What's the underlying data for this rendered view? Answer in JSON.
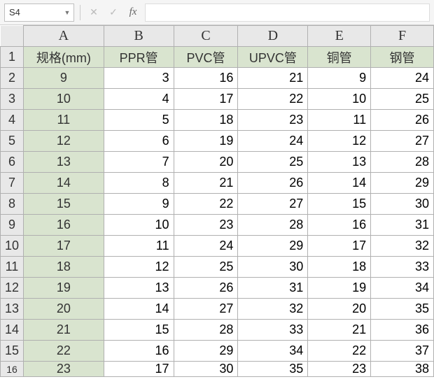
{
  "formula_bar": {
    "name_box": "S4",
    "formula_value": ""
  },
  "columns": [
    "A",
    "B",
    "C",
    "D",
    "E",
    "F"
  ],
  "header_row": {
    "A": "规格(mm)",
    "B": "PPR管",
    "C": "PVC管",
    "D": "UPVC管",
    "E": "铜管",
    "F": "钢管"
  },
  "rows": [
    {
      "n": "1",
      "type": "header"
    },
    {
      "n": "2",
      "spec": "9",
      "v": [
        "3",
        "16",
        "21",
        "9",
        "24"
      ]
    },
    {
      "n": "3",
      "spec": "10",
      "v": [
        "4",
        "17",
        "22",
        "10",
        "25"
      ]
    },
    {
      "n": "4",
      "spec": "11",
      "v": [
        "5",
        "18",
        "23",
        "11",
        "26"
      ]
    },
    {
      "n": "5",
      "spec": "12",
      "v": [
        "6",
        "19",
        "24",
        "12",
        "27"
      ]
    },
    {
      "n": "6",
      "spec": "13",
      "v": [
        "7",
        "20",
        "25",
        "13",
        "28"
      ]
    },
    {
      "n": "7",
      "spec": "14",
      "v": [
        "8",
        "21",
        "26",
        "14",
        "29"
      ]
    },
    {
      "n": "8",
      "spec": "15",
      "v": [
        "9",
        "22",
        "27",
        "15",
        "30"
      ]
    },
    {
      "n": "9",
      "spec": "16",
      "v": [
        "10",
        "23",
        "28",
        "16",
        "31"
      ]
    },
    {
      "n": "10",
      "spec": "17",
      "v": [
        "11",
        "24",
        "29",
        "17",
        "32"
      ]
    },
    {
      "n": "11",
      "spec": "18",
      "v": [
        "12",
        "25",
        "30",
        "18",
        "33"
      ]
    },
    {
      "n": "12",
      "spec": "19",
      "v": [
        "13",
        "26",
        "31",
        "19",
        "34"
      ]
    },
    {
      "n": "13",
      "spec": "20",
      "v": [
        "14",
        "27",
        "32",
        "20",
        "35"
      ]
    },
    {
      "n": "14",
      "spec": "21",
      "v": [
        "15",
        "28",
        "33",
        "21",
        "36"
      ]
    },
    {
      "n": "15",
      "spec": "22",
      "v": [
        "16",
        "29",
        "34",
        "22",
        "37"
      ]
    }
  ],
  "partial_row": {
    "n": "16",
    "spec": "23",
    "v": [
      "17",
      "30",
      "35",
      "23",
      "38"
    ]
  }
}
